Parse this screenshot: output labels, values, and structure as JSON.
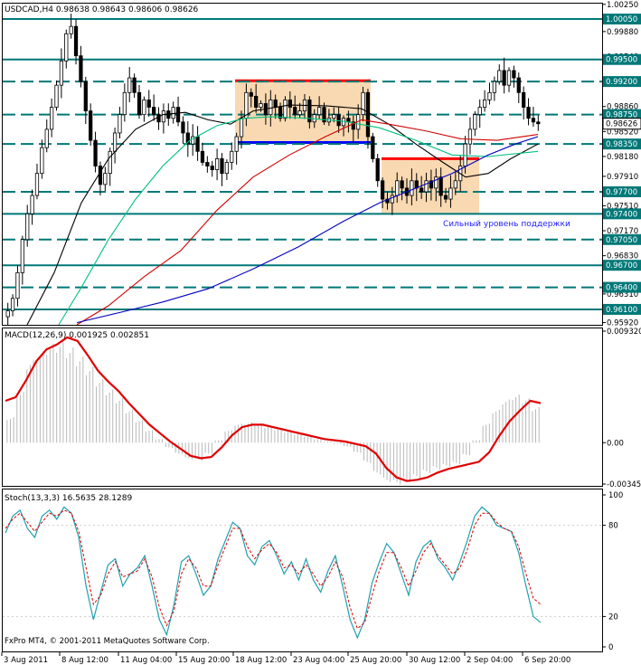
{
  "chart_data": [
    {
      "type": "candlestick",
      "title": "USDCAD,H4  0.98638 0.98643 0.98606 0.98626",
      "ylim": [
        0.9589,
        1.0026
      ],
      "y_ticks": [
        "1.00250",
        "0.99880",
        "0.99540",
        "0.99200",
        "0.98860",
        "0.98520",
        "0.98180",
        "0.97910",
        "0.97510",
        "0.97170",
        "0.96830",
        "0.96310",
        "0.95920"
      ],
      "current_price": "0.98626",
      "horizontal_levels": [
        {
          "label": "1.00050",
          "price": 1.0005,
          "style": "solid"
        },
        {
          "label": "0.99500",
          "price": 0.995,
          "style": "solid"
        },
        {
          "label": "0.99200",
          "price": 0.992,
          "style": "dashed"
        },
        {
          "label": "0.98750",
          "price": 0.9875,
          "style": "dashed"
        },
        {
          "label": "0.98350",
          "price": 0.9835,
          "style": "dashed"
        },
        {
          "label": "0.97700",
          "price": 0.977,
          "style": "dashed"
        },
        {
          "label": "0.97400",
          "price": 0.974,
          "style": "solid"
        },
        {
          "label": "0.97050",
          "price": 0.9705,
          "style": "dashed"
        },
        {
          "label": "0.96700",
          "price": 0.967,
          "style": "solid"
        },
        {
          "label": "0.96400",
          "price": 0.964,
          "style": "dashed"
        },
        {
          "label": "0.96100",
          "price": 0.961,
          "style": "solid"
        }
      ],
      "annotation": "Сильный уровень поддержки",
      "close_path": [
        0.9608,
        0.9625,
        0.966,
        0.9705,
        0.974,
        0.9765,
        0.9795,
        0.983,
        0.9855,
        0.9885,
        0.9915,
        0.9948,
        0.9985,
        0.9995,
        0.9955,
        0.992,
        0.988,
        0.984,
        0.9805,
        0.978,
        0.9795,
        0.9825,
        0.985,
        0.9875,
        0.9905,
        0.9925,
        0.9905,
        0.9875,
        0.9895,
        0.9885,
        0.9875,
        0.9865,
        0.988,
        0.987,
        0.9885,
        0.9865,
        0.985,
        0.9835,
        0.9845,
        0.9825,
        0.981,
        0.9805,
        0.98,
        0.9815,
        0.9795,
        0.981,
        0.9825,
        0.9845,
        0.987,
        0.9905,
        0.99,
        0.9885,
        0.989,
        0.9875,
        0.9895,
        0.9885,
        0.987,
        0.9895,
        0.9885,
        0.9875,
        0.988,
        0.9895,
        0.9865,
        0.9875,
        0.9885,
        0.9865,
        0.987,
        0.9875,
        0.986,
        0.987,
        0.9865,
        0.9855,
        0.9875,
        0.9905,
        0.9845,
        0.9815,
        0.9785,
        0.976,
        0.9755,
        0.9765,
        0.9785,
        0.9775,
        0.9765,
        0.9785,
        0.9775,
        0.977,
        0.9785,
        0.9775,
        0.979,
        0.9765,
        0.976,
        0.9775,
        0.9785,
        0.9805,
        0.9835,
        0.9855,
        0.9875,
        0.9885,
        0.9895,
        0.9905,
        0.992,
        0.9935,
        0.9915,
        0.9935,
        0.9925,
        0.9905,
        0.9885,
        0.987,
        0.9865,
        0.98626
      ],
      "moving_averages": [
        {
          "color": "#000000",
          "points": [
            [
              30,
              0.9589
            ],
            [
              60,
              0.966
            ],
            [
              90,
              0.9755
            ],
            [
              120,
              0.9815
            ],
            [
              150,
              0.9855
            ],
            [
              180,
              0.9875
            ],
            [
              205,
              0.9878
            ],
            [
              230,
              0.9868
            ],
            [
              255,
              0.9862
            ],
            [
              280,
              0.988
            ],
            [
              320,
              0.9888
            ],
            [
              360,
              0.9887
            ],
            [
              400,
              0.9883
            ],
            [
              430,
              0.9862
            ],
            [
              460,
              0.9835
            ],
            [
              490,
              0.981
            ],
            [
              515,
              0.979
            ],
            [
              540,
              0.9795
            ],
            [
              565,
              0.9815
            ],
            [
              595,
              0.9835
            ]
          ]
        },
        {
          "color": "#00c080",
          "points": [
            [
              65,
              0.9589
            ],
            [
              90,
              0.964
            ],
            [
              120,
              0.9705
            ],
            [
              150,
              0.976
            ],
            [
              180,
              0.9805
            ],
            [
              210,
              0.984
            ],
            [
              240,
              0.986
            ],
            [
              270,
              0.987
            ],
            [
              300,
              0.9872
            ],
            [
              340,
              0.987
            ],
            [
              380,
              0.9866
            ],
            [
              420,
              0.9857
            ],
            [
              460,
              0.984
            ],
            [
              500,
              0.982
            ],
            [
              540,
              0.9818
            ],
            [
              595,
              0.9825
            ]
          ]
        },
        {
          "color": "#d00000",
          "points": [
            [
              85,
              0.9589
            ],
            [
              120,
              0.9615
            ],
            [
              160,
              0.9655
            ],
            [
              200,
              0.969
            ],
            [
              240,
              0.9745
            ],
            [
              280,
              0.979
            ],
            [
              320,
              0.982
            ],
            [
              360,
              0.9845
            ],
            [
              400,
              0.9868
            ],
            [
              430,
              0.9862
            ],
            [
              470,
              0.9853
            ],
            [
              510,
              0.9842
            ],
            [
              550,
              0.984
            ],
            [
              595,
              0.9848
            ]
          ]
        },
        {
          "color": "#0000c0",
          "points": [
            [
              85,
              0.9592
            ],
            [
              130,
              0.9605
            ],
            [
              180,
              0.962
            ],
            [
              230,
              0.9638
            ],
            [
              280,
              0.9665
            ],
            [
              330,
              0.9695
            ],
            [
              380,
              0.973
            ],
            [
              420,
              0.9755
            ],
            [
              460,
              0.9775
            ],
            [
              500,
              0.9795
            ],
            [
              540,
              0.982
            ],
            [
              570,
              0.9835
            ],
            [
              595,
              0.9845
            ]
          ]
        }
      ],
      "boxes": [
        {
          "x0": 260,
          "x1": 410,
          "top": 0.9921,
          "bottom": 0.9837,
          "top_line_color": "#ff0000",
          "bottom_line_color": "#0000ff"
        },
        {
          "x0": 422,
          "x1": 530,
          "top": 0.9815,
          "bottom": 0.974,
          "top_line_color": "#ff0000",
          "bottom_line_color": null
        }
      ]
    },
    {
      "type": "macd",
      "title": "MACD(12,26,9) 0.001925 0.002851",
      "y_ticks": [
        "0.009320",
        "0.00",
        "-0.003457"
      ],
      "ylim": [
        -0.003457,
        0.00932
      ],
      "signal": [
        0.0035,
        0.0038,
        0.0052,
        0.0068,
        0.0078,
        0.0082,
        0.0088,
        0.0085,
        0.0073,
        0.006,
        0.0051,
        0.0043,
        0.0033,
        0.0024,
        0.0015,
        0.0008,
        0.0001,
        -0.0005,
        -0.0011,
        -0.0013,
        -0.0012,
        -0.0004,
        0.0006,
        0.0013,
        0.0015,
        0.0015,
        0.0013,
        0.0011,
        0.0009,
        0.0007,
        0.0005,
        0.0003,
        0.0002,
        0.0001,
        -0.0001,
        -0.0003,
        -0.0009,
        -0.0021,
        -0.0029,
        -0.0032,
        -0.0031,
        -0.0029,
        -0.0025,
        -0.0022,
        -0.002,
        -0.0018,
        -0.0016,
        -0.0008,
        0.0006,
        0.0018,
        0.0027,
        0.0035,
        0.0033
      ],
      "histogram": [
        0.002,
        0.004,
        0.0065,
        0.0072,
        0.0078,
        0.008,
        0.0075,
        0.0068,
        0.006,
        0.005,
        0.0042,
        0.0035,
        0.0026,
        0.0018,
        0.001,
        0.0003,
        -0.0004,
        -0.0009,
        -0.0013,
        -0.0014,
        -0.0009,
        0.0002,
        0.001,
        0.0015,
        0.0016,
        0.0015,
        0.0013,
        0.0011,
        0.0009,
        0.0007,
        0.0005,
        0.0003,
        0.0001,
        -0.0001,
        -0.0003,
        -0.0008,
        -0.0016,
        -0.0025,
        -0.0031,
        -0.0033,
        -0.0031,
        -0.0028,
        -0.0024,
        -0.0021,
        -0.0019,
        -0.0017,
        -0.001,
        0.0002,
        0.0015,
        0.0026,
        0.0034,
        0.0038,
        0.0035,
        0.0028
      ]
    },
    {
      "type": "line",
      "title": "Stoch(13,3,3) 16.5635 28.1289",
      "ylim": [
        0,
        100
      ],
      "y_ticks": [
        "100",
        "80",
        "20",
        "0"
      ],
      "main": [
        75,
        86,
        90,
        78,
        72,
        86,
        90,
        84,
        92,
        88,
        72,
        40,
        18,
        36,
        54,
        58,
        40,
        48,
        52,
        60,
        40,
        18,
        8,
        28,
        56,
        60,
        48,
        34,
        40,
        58,
        70,
        82,
        78,
        60,
        54,
        66,
        70,
        60,
        48,
        56,
        44,
        58,
        44,
        36,
        50,
        60,
        40,
        18,
        6,
        18,
        42,
        56,
        68,
        62,
        48,
        34,
        56,
        66,
        70,
        58,
        52,
        44,
        56,
        70,
        86,
        92,
        88,
        80,
        78,
        76,
        62,
        40,
        20,
        16
      ],
      "signal": [
        78,
        84,
        88,
        82,
        76,
        82,
        88,
        86,
        90,
        88,
        76,
        52,
        28,
        34,
        48,
        56,
        46,
        48,
        50,
        58,
        46,
        26,
        14,
        24,
        48,
        58,
        52,
        40,
        40,
        54,
        66,
        78,
        78,
        66,
        58,
        64,
        68,
        62,
        52,
        54,
        48,
        54,
        48,
        40,
        46,
        56,
        46,
        26,
        12,
        16,
        34,
        50,
        62,
        62,
        52,
        40,
        50,
        62,
        68,
        60,
        54,
        48,
        52,
        64,
        80,
        88,
        88,
        82,
        78,
        76,
        66,
        48,
        32,
        28
      ],
      "x_ticks": [
        "3 Aug 2011",
        "8 Aug 12:00",
        "11 Aug 04:00",
        "15 Aug 20:00",
        "18 Aug 12:00",
        "23 Aug 04:00",
        "25 Aug 20:00",
        "30 Aug 12:00",
        "2 Sep 04:00",
        "6 Sep 20:00"
      ]
    }
  ],
  "footer": {
    "copyright": "FxPro MT4, © 2001-2011 MetaQuotes Software Corp."
  }
}
